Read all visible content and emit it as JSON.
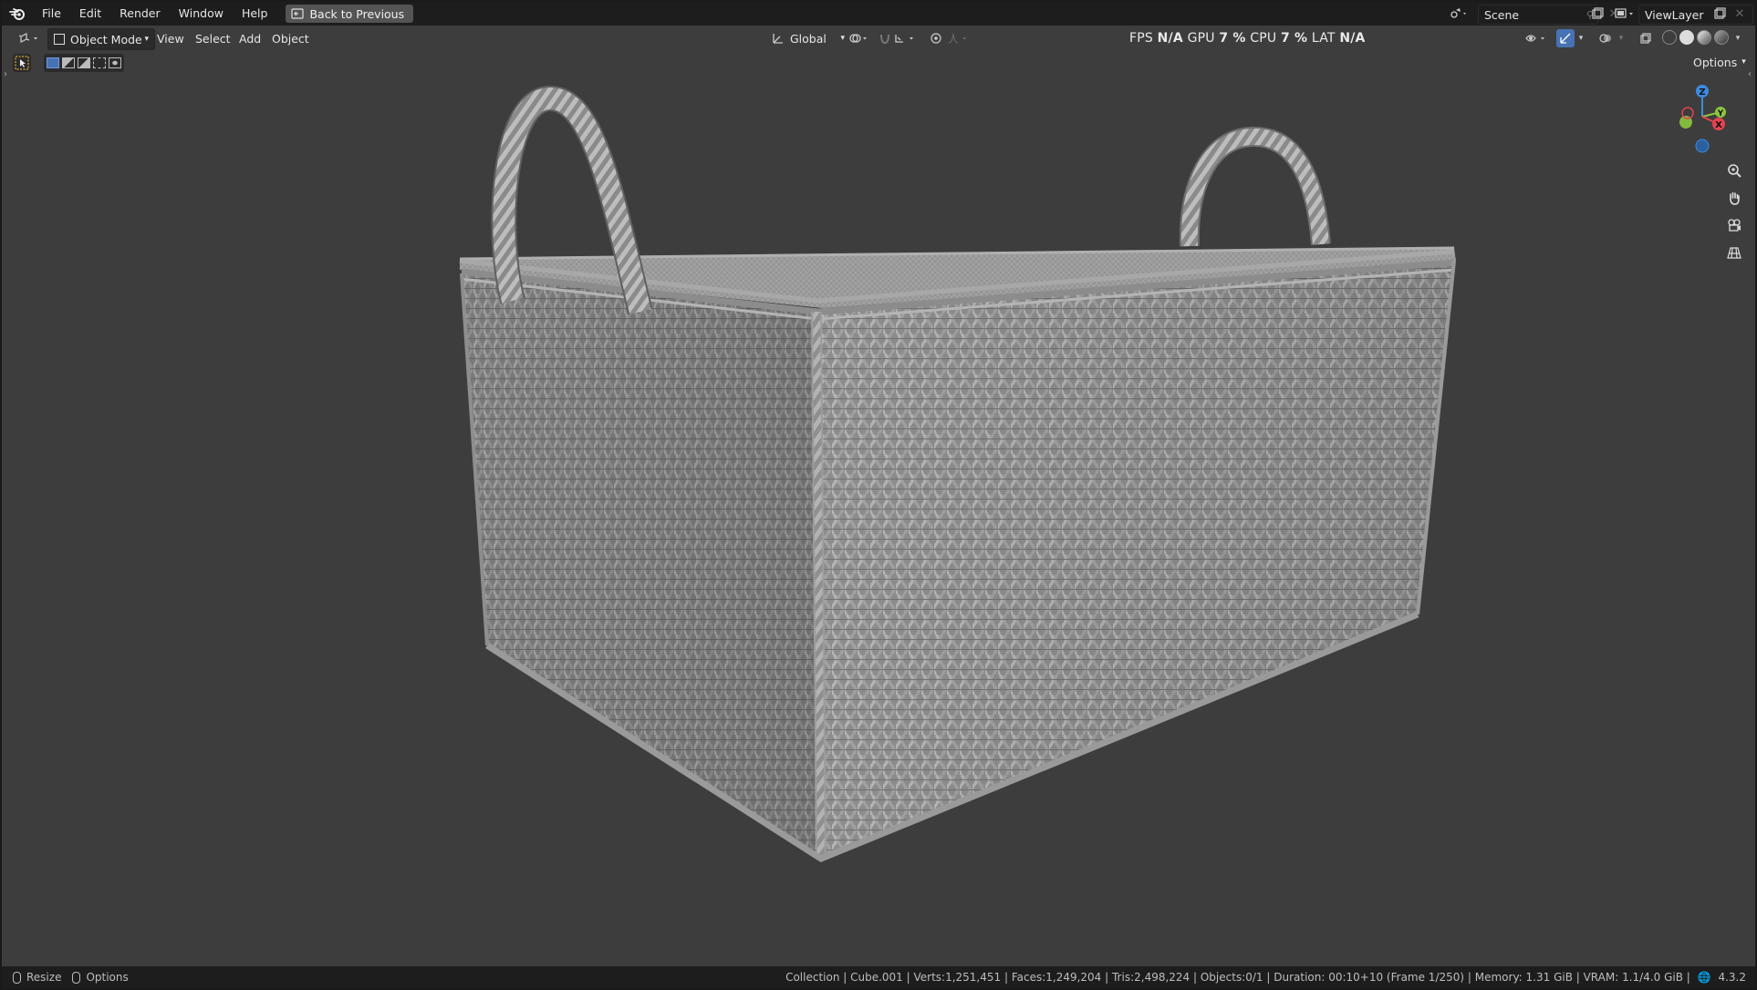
{
  "menu": {
    "items": [
      "File",
      "Edit",
      "Render",
      "Window",
      "Help"
    ],
    "back_button": "Back to Previous"
  },
  "workspace": {
    "scene_label": "Scene",
    "view_layer_label": "ViewLayer"
  },
  "header": {
    "mode": "Object Mode",
    "menus": [
      "View",
      "Select",
      "Add",
      "Object"
    ],
    "transform_orientation": "Global",
    "options_label": "Options"
  },
  "stats": {
    "fps_label": "FPS",
    "fps_value": "N/A",
    "gpu_label": "GPU",
    "gpu_value": "7 %",
    "cpu_label": "CPU",
    "cpu_value": "7 %",
    "lat_label": "LAT",
    "lat_value": "N/A"
  },
  "gizmo": {
    "z": "Z",
    "y": "Y",
    "x": "X"
  },
  "statusbar": {
    "left": [
      "Resize",
      "Options"
    ],
    "info": "Collection | Cube.001 | Verts:1,251,451 | Faces:1,249,204 | Tris:2,498,224 | Objects:0/1 | Duration: 00:10+10 (Frame 1/250) | Memory: 1.31 GiB | VRAM: 1.1/4.0 GiB |",
    "version": "4.3.2"
  },
  "colors": {
    "background": "#3d3d3d",
    "menubar": "#1d1d1d",
    "accent": "#4772b3",
    "axis_x": "#e5434f",
    "axis_y": "#8cc63f",
    "axis_z": "#3d8be0"
  }
}
